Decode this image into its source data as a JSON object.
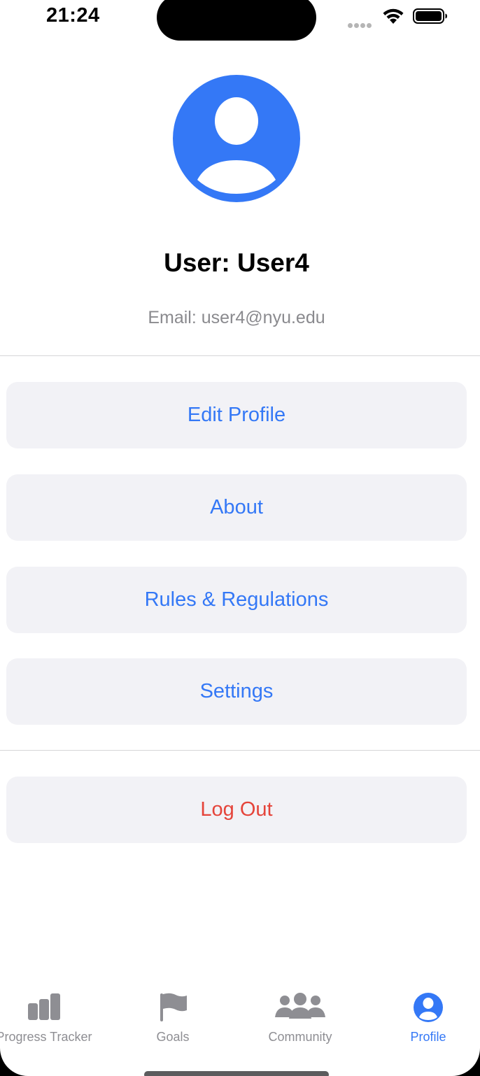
{
  "status_bar": {
    "time": "21:24"
  },
  "profile": {
    "title": "User: User4",
    "email": "Email: user4@nyu.edu",
    "avatar_icon": "person-circle-icon"
  },
  "menu": {
    "edit_profile": "Edit Profile",
    "about": "About",
    "rules": "Rules & Regulations",
    "settings": "Settings",
    "logout": "Log Out"
  },
  "tabs": [
    {
      "label": "Progress Tracker",
      "icon": "bar-chart-icon",
      "active": false
    },
    {
      "label": "Goals",
      "icon": "flag-icon",
      "active": false
    },
    {
      "label": "Community",
      "icon": "people-icon",
      "active": false
    },
    {
      "label": "Profile",
      "icon": "person-circle-icon",
      "active": true
    }
  ],
  "colors": {
    "accent": "#3478f6",
    "destructive": "#e5443a",
    "button_bg": "#f2f2f6",
    "secondary_text": "#8a8a8e",
    "tab_inactive": "#8e8e93"
  }
}
